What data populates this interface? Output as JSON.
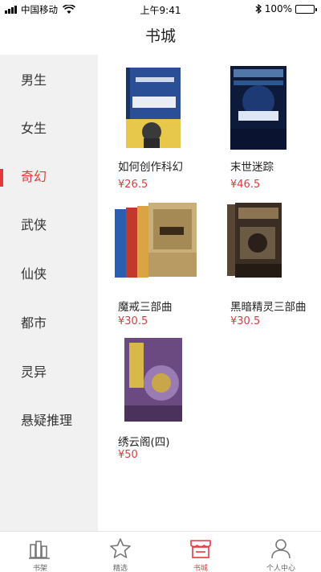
{
  "status_bar": {
    "carrier": "中国移动",
    "time": "上午9:41",
    "battery": "100%"
  },
  "nav": {
    "title": "书城"
  },
  "categories": [
    {
      "label": "男生",
      "active": false
    },
    {
      "label": "女生",
      "active": false
    },
    {
      "label": "奇幻",
      "active": true
    },
    {
      "label": "武侠",
      "active": false
    },
    {
      "label": "仙侠",
      "active": false
    },
    {
      "label": "都市",
      "active": false
    },
    {
      "label": "灵异",
      "active": false
    },
    {
      "label": "悬疑推理",
      "active": false
    }
  ],
  "books": [
    {
      "title": "如何创作科幻",
      "price": "¥26.5",
      "cover_color": "#2b4f96"
    },
    {
      "title": "末世迷踪",
      "price": "¥46.5",
      "cover_color": "#0e1a3a"
    },
    {
      "title": "魔戒三部曲",
      "price": "¥30.5",
      "cover_color": "#c9b07a"
    },
    {
      "title": "黑暗精灵三部曲",
      "price": "¥30.5",
      "cover_color": "#3a2e24"
    },
    {
      "title": "绣云阁(四)",
      "price": "¥50",
      "cover_color": "#6b4a82"
    }
  ],
  "tabs": [
    {
      "label": "书架",
      "icon": "bookshelf-icon",
      "active": false
    },
    {
      "label": "精选",
      "icon": "star-icon",
      "active": false
    },
    {
      "label": "书城",
      "icon": "store-icon",
      "active": true
    },
    {
      "label": "个人中心",
      "icon": "person-icon",
      "active": false
    }
  ],
  "colors": {
    "accent": "#e4393c",
    "sidebar_bg": "#f1f1f1"
  }
}
